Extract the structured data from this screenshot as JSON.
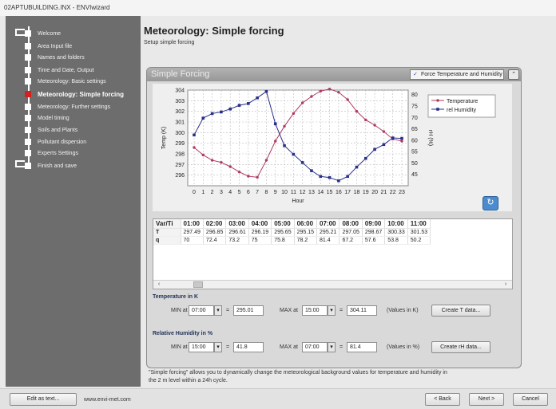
{
  "window": {
    "title": "02APTUBUILDING.INX - ENVIwizard"
  },
  "sidebar": {
    "items": [
      {
        "label": "Welcome",
        "active": false
      },
      {
        "label": "Area Input file",
        "active": false
      },
      {
        "label": "Names and folders",
        "active": false
      },
      {
        "label": "Time and Date, Output",
        "active": false
      },
      {
        "label": "Meteorology: Basic settings",
        "active": false
      },
      {
        "label": "Meteorology: Simple forcing",
        "active": true
      },
      {
        "label": "Meteorology: Further settings",
        "active": false
      },
      {
        "label": "Model timing",
        "active": false
      },
      {
        "label": "Soils and Plants",
        "active": false
      },
      {
        "label": "Pollutant dispersion",
        "active": false
      },
      {
        "label": "Experts Settings",
        "active": false
      },
      {
        "label": "Finish and save",
        "active": false
      }
    ]
  },
  "page": {
    "title": "Meteorology: Simple forcing",
    "subtitle": "Setup simple forcing"
  },
  "panel": {
    "title": "Simple Forcing",
    "force_label": "Force Temperature and Humidity",
    "force_checked": true,
    "collapse_icon": "chevron-up-icon"
  },
  "chart_data": {
    "type": "line",
    "xlabel": "Hour",
    "ylabel": "Temp (K)",
    "y2label": "rH (%)",
    "x": [
      0,
      1,
      2,
      3,
      4,
      5,
      6,
      7,
      8,
      9,
      10,
      11,
      12,
      13,
      14,
      15,
      16,
      17,
      18,
      19,
      20,
      21,
      22,
      23
    ],
    "ylim": [
      295,
      304
    ],
    "y2lim": [
      40,
      82
    ],
    "yticks": [
      296,
      297,
      298,
      299,
      300,
      301,
      302,
      303,
      304
    ],
    "y2ticks": [
      45,
      50,
      55,
      60,
      65,
      70,
      75,
      80
    ],
    "legend": "top-right",
    "series": [
      {
        "name": "Temperature",
        "color": "#b03a62",
        "axis": "left",
        "values": [
          298.6,
          297.9,
          297.4,
          297.2,
          296.8,
          296.3,
          295.9,
          295.8,
          297.4,
          299.2,
          300.6,
          301.8,
          302.8,
          303.4,
          303.9,
          304.1,
          303.8,
          303.1,
          302.0,
          301.2,
          300.7,
          300.1,
          299.4,
          299.2
        ]
      },
      {
        "name": "rel Humidity",
        "color": "#2a2f8a",
        "axis": "right",
        "values": [
          62.3,
          69.7,
          71.7,
          72.4,
          73.7,
          75.3,
          76.1,
          78.6,
          81.4,
          67.2,
          57.6,
          53.8,
          50.2,
          46.6,
          44.1,
          43.6,
          42.2,
          44.1,
          48.2,
          52.0,
          56.0,
          58.1,
          61.0,
          60.8
        ]
      }
    ]
  },
  "refresh_icon": "refresh-icon",
  "table": {
    "columns": [
      "Var/Ti",
      "01:00",
      "02:00",
      "03:00",
      "04:00",
      "05:00",
      "06:00",
      "07:00",
      "08:00",
      "09:00",
      "10:00",
      "11:00"
    ],
    "rows": [
      [
        "T",
        "297.49",
        "296.85",
        "296.61",
        "296.19",
        "295.65",
        "295.15",
        "295.21",
        "297.05",
        "298.67",
        "300.33",
        "301.53"
      ],
      [
        "q",
        "70",
        "72.4",
        "73.2",
        "75",
        "75.8",
        "78.2",
        "81.4",
        "67.2",
        "57.6",
        "53.8",
        "50.2"
      ]
    ]
  },
  "temperature": {
    "heading": "Temperature in K",
    "min_label": "MIN at",
    "min_time": "07:00",
    "min_value": "295.01",
    "max_label": "MAX at",
    "max_time": "15:00",
    "max_value": "304.11",
    "equals": "=",
    "units_note": "(Values in K)",
    "create_button": "Create T data..."
  },
  "humidity": {
    "heading": "Relative Humidity in %",
    "min_label": "MIN at",
    "min_time": "15:00",
    "min_value": "41.8",
    "max_label": "MAX at",
    "max_time": "07:00",
    "max_value": "81.4",
    "equals": "=",
    "units_note": "(Values in %)",
    "create_button": "Create rH data..."
  },
  "note": "\"Simple forcing\" allows you to dynamically change the meteorological background values for temperature and humidity in the 2 m level within a 24h cycle.",
  "bottom": {
    "edit_button": "Edit as text...",
    "website": "www.envi-met.com",
    "back_button": "< Back",
    "next_button": "Next >",
    "cancel_button": "Cancel"
  }
}
